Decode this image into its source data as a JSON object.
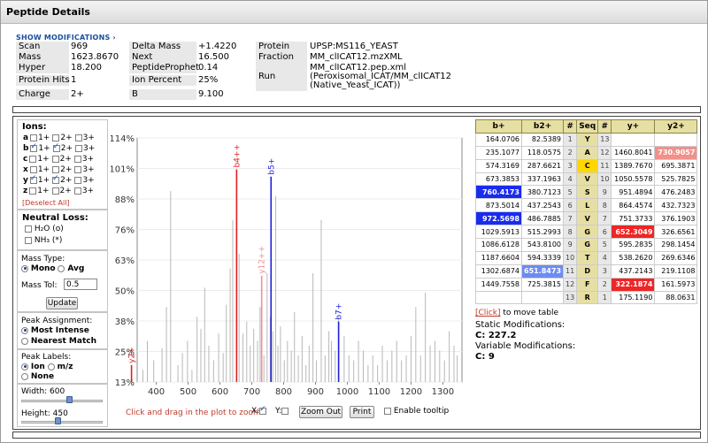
{
  "page_title": "Peptide Details",
  "show_modifications": "SHOW MODIFICATIONS ›",
  "info": {
    "scan_label": "Scan",
    "scan": "969",
    "mass_label": "Mass",
    "mass": "1623.8670",
    "hyper_label": "Hyper",
    "hyper": "18.200",
    "protein_hits_label": "Protein Hits",
    "protein_hits": "1",
    "charge_label": "Charge",
    "charge": "2+",
    "delta_mass_label": "Delta Mass",
    "delta_mass": "+1.4220",
    "next_label": "Next",
    "next": "16.500",
    "peptide_prophet_label": "PeptideProphet",
    "peptide_prophet": "0.14",
    "ion_percent_label": "Ion Percent",
    "ion_percent": "25%",
    "b_label": "B",
    "b": "9.100",
    "protein_label": "Protein",
    "protein": "UPSP:MS116_YEAST",
    "fraction_label": "Fraction",
    "fraction": "MM_clICAT12.mzXML",
    "run_label": "Run",
    "run_lines": [
      "MM_clICAT12.pep.xml",
      "(Peroxisomal_ICAT/MM_clICAT12",
      "(Native_Yeast_ICAT))"
    ]
  },
  "controls": {
    "ions_title": "Ions:",
    "ion_rows": [
      {
        "ion": "a",
        "c1": false,
        "c2": false,
        "c3": false
      },
      {
        "ion": "b",
        "c1": true,
        "c2": true,
        "c3": false
      },
      {
        "ion": "c",
        "c1": false,
        "c2": false,
        "c3": false
      },
      {
        "ion": "x",
        "c1": false,
        "c2": false,
        "c3": false
      },
      {
        "ion": "y",
        "c1": true,
        "c2": true,
        "c3": false
      },
      {
        "ion": "z",
        "c1": false,
        "c2": false,
        "c3": false
      }
    ],
    "charge_labels": [
      "1+",
      "2+",
      "3+"
    ],
    "deselect_all": "[Deselect All]",
    "neutral_loss_title": "Neutral Loss:",
    "h2o": "H₂O (o)",
    "nh3": "NH₃ (*)",
    "mass_type_label": "Mass Type:",
    "mono": "Mono",
    "avg": "Avg",
    "mass_tol_label": "Mass Tol:",
    "mass_tol": "0.5",
    "update": "Update",
    "peak_assignment_label": "Peak Assignment:",
    "most_intense": "Most Intense",
    "nearest_match": "Nearest Match",
    "peak_labels_label": "Peak Labels:",
    "ion_opt": "Ion",
    "mz_opt": "m/z",
    "none_opt": "None",
    "width_label": "Width: 600",
    "width_value": 600,
    "height_label": "Height: 450",
    "height_value": 450
  },
  "plot": {
    "y_ticks": [
      "114%",
      "101%",
      "88%",
      "76%",
      "63%",
      "50%",
      "38%",
      "25%",
      "13%"
    ],
    "x_ticks": [
      "400",
      "500",
      "600",
      "700",
      "800",
      "900",
      "1000",
      "1100",
      "1200",
      "1300"
    ],
    "hint": "Click and drag in the plot to zoom",
    "x_label": "X:",
    "y_label": "Y:",
    "zoom_out": "Zoom Out",
    "print": "Print",
    "enable_tooltip": "Enable tooltip",
    "peak_labels": [
      {
        "text": "b4++",
        "color": "#e02020"
      },
      {
        "text": "b5+",
        "color": "#2020e0"
      },
      {
        "text": "y12++",
        "color": "#f09090"
      },
      {
        "text": "b7+",
        "color": "#2020e0"
      },
      {
        "text": "y2+",
        "color": "#e02020"
      }
    ]
  },
  "chart_data": {
    "type": "bar",
    "xlabel": "",
    "ylabel": "",
    "xlim": [
      340,
      1360
    ],
    "ylim": [
      13,
      114
    ],
    "x_ticks": [
      400,
      500,
      600,
      700,
      800,
      900,
      1000,
      1100,
      1200,
      1300
    ],
    "y_ticks": [
      "114%",
      "101%",
      "88%",
      "76%",
      "63%",
      "50%",
      "38%",
      "25%",
      "13%"
    ],
    "series": [
      {
        "name": "",
        "color": "#b8b8b8",
        "peaks": [
          [
            358,
            18
          ],
          [
            372,
            30
          ],
          [
            392,
            22
          ],
          [
            418,
            27
          ],
          [
            432,
            44
          ],
          [
            445,
            92
          ],
          [
            468,
            20
          ],
          [
            482,
            25
          ],
          [
            498,
            30
          ],
          [
            512,
            18
          ],
          [
            528,
            40
          ],
          [
            540,
            35
          ],
          [
            552,
            52
          ],
          [
            565,
            28
          ],
          [
            580,
            22
          ],
          [
            596,
            33
          ],
          [
            610,
            25
          ],
          [
            620,
            45
          ],
          [
            632,
            60
          ],
          [
            640,
            80
          ],
          [
            660,
            66
          ],
          [
            672,
            33
          ],
          [
            684,
            38
          ],
          [
            695,
            28
          ],
          [
            706,
            35
          ],
          [
            718,
            30
          ],
          [
            726,
            44
          ],
          [
            738,
            24
          ],
          [
            748,
            58
          ],
          [
            758,
            40
          ],
          [
            766,
            34
          ],
          [
            775,
            90
          ],
          [
            782,
            28
          ],
          [
            790,
            36
          ],
          [
            802,
            22
          ],
          [
            812,
            30
          ],
          [
            824,
            26
          ],
          [
            834,
            42
          ],
          [
            846,
            24
          ],
          [
            858,
            32
          ],
          [
            870,
            20
          ],
          [
            880,
            28
          ],
          [
            892,
            58
          ],
          [
            903,
            22
          ],
          [
            918,
            80
          ],
          [
            930,
            24
          ],
          [
            942,
            34
          ],
          [
            950,
            30
          ],
          [
            962,
            26
          ],
          [
            972,
            40
          ],
          [
            990,
            32
          ],
          [
            1005,
            24
          ],
          [
            1020,
            22
          ],
          [
            1035,
            30
          ],
          [
            1050,
            26
          ],
          [
            1065,
            20
          ],
          [
            1080,
            24
          ],
          [
            1095,
            20
          ],
          [
            1110,
            28
          ],
          [
            1125,
            22
          ],
          [
            1140,
            26
          ],
          [
            1155,
            30
          ],
          [
            1170,
            22
          ],
          [
            1185,
            24
          ],
          [
            1200,
            32
          ],
          [
            1215,
            44
          ],
          [
            1230,
            24
          ],
          [
            1245,
            50
          ],
          [
            1260,
            28
          ],
          [
            1275,
            30
          ],
          [
            1290,
            26
          ],
          [
            1305,
            22
          ],
          [
            1320,
            34
          ],
          [
            1335,
            28
          ],
          [
            1345,
            24
          ]
        ]
      },
      {
        "name": "b4++",
        "color": "#e02020",
        "peaks": [
          [
            652.3,
            101
          ]
        ]
      },
      {
        "name": "b5+",
        "color": "#2020e0",
        "peaks": [
          [
            760.4,
            98
          ]
        ]
      },
      {
        "name": "y12++",
        "color": "#f09090",
        "peaks": [
          [
            730.9,
            57
          ]
        ]
      },
      {
        "name": "b7+",
        "color": "#2020e0",
        "peaks": [
          [
            972.6,
            38
          ]
        ]
      },
      {
        "name": "y2+",
        "color": "#e02020",
        "peaks": [
          [
            322.2,
            20
          ]
        ]
      }
    ]
  },
  "table": {
    "headers": [
      "b+",
      "b2+",
      "#",
      "Seq",
      "#",
      "y+",
      "y2+"
    ],
    "rows": [
      {
        "b1": "164.0706",
        "b2": "82.5389",
        "n1": "1",
        "seq": "Y",
        "n2": "13",
        "y1": "",
        "y2": ""
      },
      {
        "b1": "235.1077",
        "b2": "118.0575",
        "n1": "2",
        "seq": "A",
        "n2": "12",
        "y1": "1460.8041",
        "y2": "730.9057"
      },
      {
        "b1": "574.3169",
        "b2": "287.6621",
        "n1": "3",
        "seq": "C",
        "n2": "11",
        "y1": "1389.7670",
        "y2": "695.3871"
      },
      {
        "b1": "673.3853",
        "b2": "337.1963",
        "n1": "4",
        "seq": "V",
        "n2": "10",
        "y1": "1050.5578",
        "y2": "525.7825"
      },
      {
        "b1": "760.4173",
        "b2": "380.7123",
        "n1": "5",
        "seq": "S",
        "n2": "9",
        "y1": "951.4894",
        "y2": "476.2483"
      },
      {
        "b1": "873.5014",
        "b2": "437.2543",
        "n1": "6",
        "seq": "L",
        "n2": "8",
        "y1": "864.4574",
        "y2": "432.7323"
      },
      {
        "b1": "972.5698",
        "b2": "486.7885",
        "n1": "7",
        "seq": "V",
        "n2": "7",
        "y1": "751.3733",
        "y2": "376.1903"
      },
      {
        "b1": "1029.5913",
        "b2": "515.2993",
        "n1": "8",
        "seq": "G",
        "n2": "6",
        "y1": "652.3049",
        "y2": "326.6561"
      },
      {
        "b1": "1086.6128",
        "b2": "543.8100",
        "n1": "9",
        "seq": "G",
        "n2": "5",
        "y1": "595.2835",
        "y2": "298.1454"
      },
      {
        "b1": "1187.6604",
        "b2": "594.3339",
        "n1": "10",
        "seq": "T",
        "n2": "4",
        "y1": "538.2620",
        "y2": "269.6346"
      },
      {
        "b1": "1302.6874",
        "b2": "651.8473",
        "n1": "11",
        "seq": "D",
        "n2": "3",
        "y1": "437.2143",
        "y2": "219.1108"
      },
      {
        "b1": "1449.7558",
        "b2": "725.3815",
        "n1": "12",
        "seq": "F",
        "n2": "2",
        "y1": "322.1874",
        "y2": "161.5973"
      },
      {
        "b1": "",
        "b2": "",
        "n1": "13",
        "seq": "R",
        "n2": "1",
        "y1": "175.1190",
        "y2": "88.0631"
      }
    ],
    "highlights": {
      "bhit": [
        "4:b1",
        "6:b1"
      ],
      "blhit": [
        "10:b2"
      ],
      "yhit": [
        "7:y1",
        "11:y1"
      ],
      "ylhit": [
        "1:y2"
      ],
      "seqhl": [
        "2"
      ]
    }
  },
  "table_footer": {
    "click_link": "[Click]",
    "click_text": " to move table",
    "static_mods_label": "Static Modifications:",
    "static_mods": "C: 227.2",
    "variable_mods_label": "Variable Modifications:",
    "variable_mods": "C: 9"
  }
}
